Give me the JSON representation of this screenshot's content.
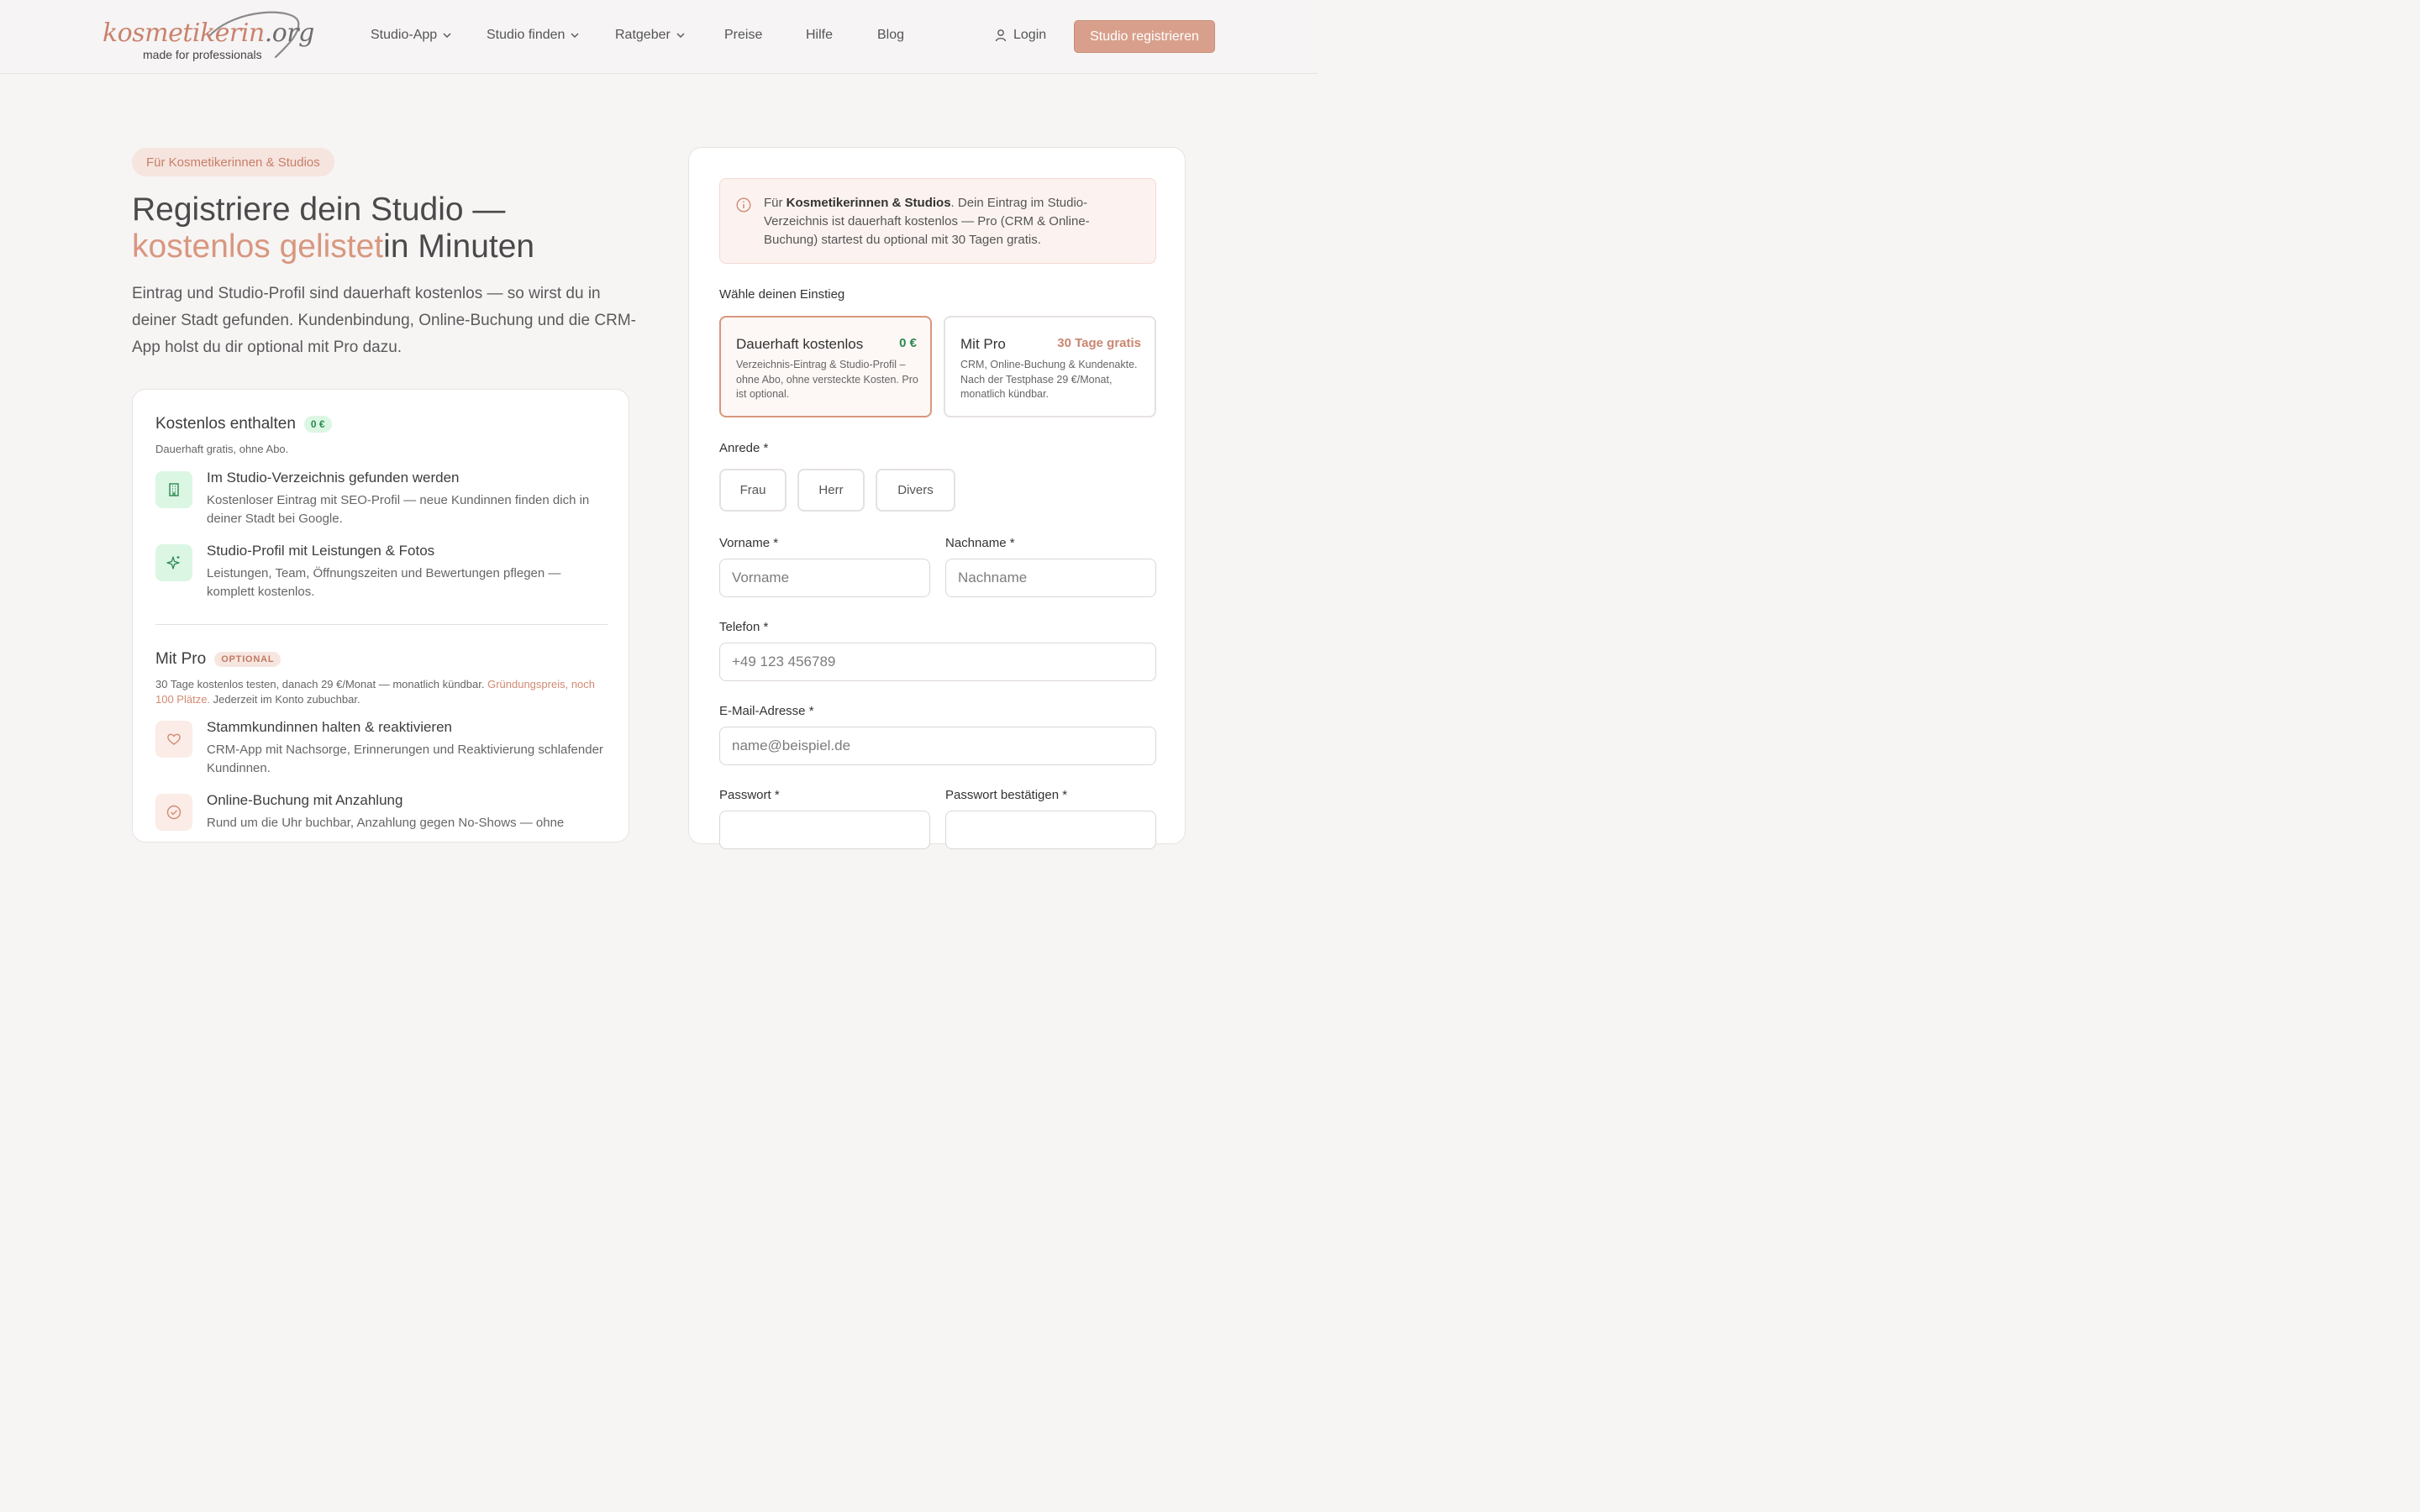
{
  "header": {
    "logo_word": "kosmetikerin",
    "logo_tld": ".org",
    "logo_tagline": "made for professionals",
    "nav": [
      {
        "label": "Studio-App",
        "dropdown": true
      },
      {
        "label": "Studio finden",
        "dropdown": true
      },
      {
        "label": "Ratgeber",
        "dropdown": true
      },
      {
        "label": "Preise",
        "dropdown": false
      },
      {
        "label": "Hilfe",
        "dropdown": false
      },
      {
        "label": "Blog",
        "dropdown": false
      }
    ],
    "login_label": "Login",
    "register_label": "Studio registrieren"
  },
  "hero": {
    "eyebrow": "Für Kosmetikerinnen & Studios",
    "title_line1": "Registriere dein Studio —",
    "title_accent": "kostenlos gelistet",
    "title_tail": "in Minuten",
    "lead": "Eintrag und Studio-Profil sind dauerhaft kostenlos — so wirst du in deiner Stadt gefunden. Kundenbindung, Online-Buchung und die CRM-App holst du dir optional mit Pro dazu."
  },
  "features": {
    "free": {
      "title": "Kostenlos enthalten",
      "badge": "0 €",
      "subtitle": "Dauerhaft gratis, ohne Abo.",
      "items": [
        {
          "icon": "building-icon",
          "title": "Im Studio-Verzeichnis gefunden werden",
          "desc": "Kostenloser Eintrag mit SEO-Profil — neue Kundinnen finden dich in deiner Stadt bei Google."
        },
        {
          "icon": "sparkle-icon",
          "title": "Studio-Profil mit Leistungen & Fotos",
          "desc": "Leistungen, Team, Öffnungszeiten und Bewertungen pflegen — komplett kostenlos."
        }
      ]
    },
    "pro": {
      "title": "Mit Pro",
      "badge": "OPTIONAL",
      "subtitle_pre": "30 Tage kostenlos testen, danach 29 €/Monat — monatlich kündbar.",
      "subtitle_link": "Gründungspreis, noch 100 Plätze.",
      "subtitle_post": "Jederzeit im Konto zubuchbar.",
      "items": [
        {
          "icon": "heart-icon",
          "title": "Stammkundinnen halten & reaktivieren",
          "desc": "CRM-App mit Nachsorge, Erinnerungen und Reaktivierung schlafender Kundinnen."
        },
        {
          "icon": "check-circle-icon",
          "title": "Online-Buchung mit Anzahlung",
          "desc": "Rund um die Uhr buchbar, Anzahlung gegen No-Shows — ohne"
        }
      ]
    }
  },
  "form": {
    "notice_pre": "Für ",
    "notice_bold": "Kosmetikerinnen & Studios",
    "notice_post": ". Dein Eintrag im Studio-Verzeichnis ist dauerhaft kostenlos — Pro (CRM & Online-Buchung) startest du optional mit 30 Tagen gratis.",
    "choose_label": "Wähle deinen Einstieg",
    "choices": [
      {
        "title": "Dauerhaft kostenlos",
        "price": "0 €",
        "desc": "Verzeichnis-Eintrag & Studio-Profil – ohne Abo, ohne versteckte Kosten. Pro ist optional.",
        "selected": true
      },
      {
        "title": "Mit Pro",
        "price": "30 Tage gratis",
        "desc": "CRM, Online-Buchung & Kundenakte. Nach der Testphase 29 €/Monat, monatlich kündbar.",
        "selected": false
      }
    ],
    "salutation_label": "Anrede *",
    "salutations": [
      "Frau",
      "Herr",
      "Divers"
    ],
    "firstname_label": "Vorname *",
    "firstname_placeholder": "Vorname",
    "lastname_label": "Nachname *",
    "lastname_placeholder": "Nachname",
    "phone_label": "Telefon *",
    "phone_placeholder": "+49 123 456789",
    "email_label": "E-Mail-Adresse *",
    "email_placeholder": "name@beispiel.de",
    "password_label": "Passwort *",
    "password_confirm_label": "Passwort bestätigen *"
  },
  "colors": {
    "accent": "#d8977f",
    "button": "#d8a08c",
    "green": "#2b8a4f",
    "green_bg": "#dcf6e4"
  }
}
